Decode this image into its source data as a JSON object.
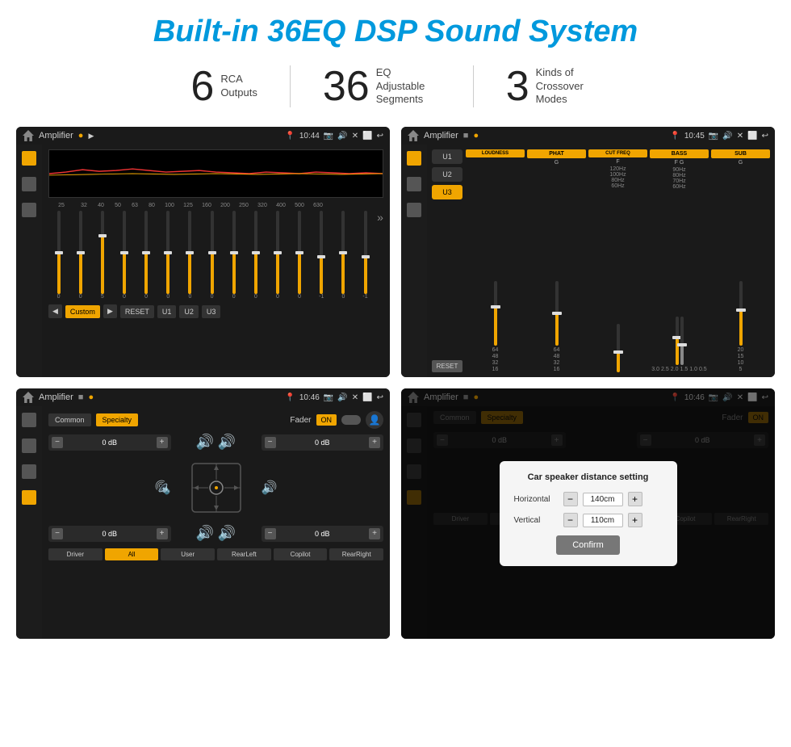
{
  "header": {
    "title": "Built-in 36EQ DSP Sound System"
  },
  "stats": [
    {
      "number": "6",
      "label": "RCA\nOutputs"
    },
    {
      "number": "36",
      "label": "EQ Adjustable\nSegments"
    },
    {
      "number": "3",
      "label": "Kinds of\nCrossover Modes"
    }
  ],
  "screens": [
    {
      "id": "screen1",
      "topbar": {
        "title": "Amplifier",
        "time": "10:44"
      },
      "type": "eq"
    },
    {
      "id": "screen2",
      "topbar": {
        "title": "Amplifier",
        "time": "10:45"
      },
      "type": "crossover"
    },
    {
      "id": "screen3",
      "topbar": {
        "title": "Amplifier",
        "time": "10:46"
      },
      "type": "fader"
    },
    {
      "id": "screen4",
      "topbar": {
        "title": "Amplifier",
        "time": "10:46"
      },
      "type": "fader-dialog"
    }
  ],
  "eq": {
    "freqs": [
      "25",
      "32",
      "40",
      "50",
      "63",
      "80",
      "100",
      "125",
      "160",
      "200",
      "250",
      "320",
      "400",
      "500",
      "630"
    ],
    "values": [
      "0",
      "0",
      "5",
      "0",
      "0",
      "0",
      "0",
      "0",
      "0",
      "0",
      "0",
      "0",
      "-1",
      "0",
      "-1"
    ],
    "thumb_positions": [
      55,
      55,
      30,
      55,
      55,
      55,
      55,
      55,
      55,
      55,
      55,
      55,
      70,
      55,
      70
    ],
    "buttons": [
      "Custom",
      "RESET",
      "U1",
      "U2",
      "U3"
    ]
  },
  "crossover": {
    "presets": [
      "U1",
      "U2",
      "U3"
    ],
    "channels": [
      {
        "name": "LOUDNESS",
        "on": true,
        "label": ""
      },
      {
        "name": "PHAT",
        "on": true,
        "label": "G"
      },
      {
        "name": "CUT FREQ",
        "on": true,
        "label": "F"
      },
      {
        "name": "BASS",
        "on": true,
        "label": "F G"
      },
      {
        "name": "SUB",
        "on": true,
        "label": "G"
      }
    ]
  },
  "fader": {
    "tabs": [
      "Common",
      "Specialty"
    ],
    "active_tab": "Specialty",
    "fader_label": "Fader",
    "on_label": "ON",
    "volumes": {
      "top_left": "0 dB",
      "top_right": "0 dB",
      "bottom_left": "0 dB",
      "bottom_right": "0 dB"
    },
    "bottom_nav": [
      "Driver",
      "RearLeft",
      "All",
      "User",
      "Copilot",
      "RearRight"
    ]
  },
  "dialog": {
    "title": "Car speaker distance setting",
    "horizontal_label": "Horizontal",
    "horizontal_value": "140cm",
    "vertical_label": "Vertical",
    "vertical_value": "110cm",
    "confirm_label": "Confirm"
  },
  "colors": {
    "accent": "#f0a500",
    "bg_dark": "#1a1a1a",
    "title_blue": "#0099dd"
  }
}
